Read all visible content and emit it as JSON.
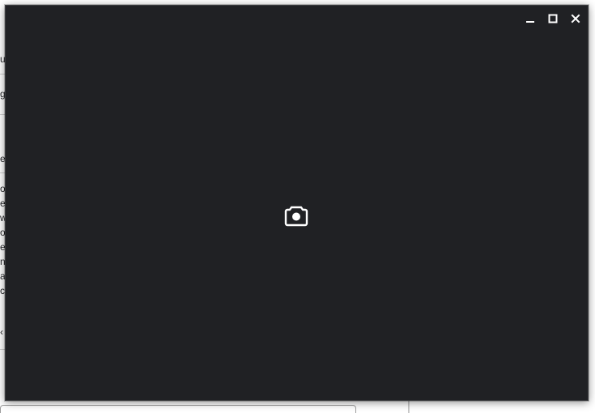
{
  "background_app": {
    "fragments": [
      "u",
      "g",
      "e",
      "o",
      "e",
      "w",
      "of",
      "e",
      "n",
      "a",
      "c",
      "‹"
    ]
  },
  "camera_window": {
    "controls": {
      "minimize": "minimize-icon",
      "maximize": "maximize-icon",
      "close": "close-icon"
    },
    "placeholder_icon": "camera-icon"
  },
  "colors": {
    "window_bg": "#202124",
    "icon_color": "#ffffff"
  }
}
